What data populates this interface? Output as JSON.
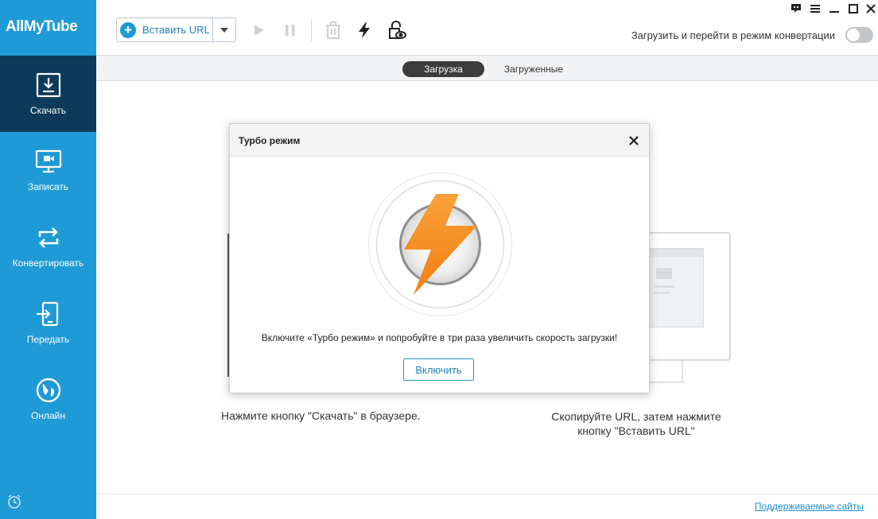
{
  "app": {
    "logo": "AllMyTube"
  },
  "sidebar": {
    "items": [
      {
        "label": "Скачать",
        "icon": "download-icon",
        "active": true
      },
      {
        "label": "Записать",
        "icon": "record-screen-icon",
        "active": false
      },
      {
        "label": "Конвертировать",
        "icon": "convert-icon",
        "active": false
      },
      {
        "label": "Передать",
        "icon": "transfer-icon",
        "active": false
      },
      {
        "label": "Онлайн",
        "icon": "globe-icon",
        "active": false
      }
    ],
    "bottom_icon": "alarm-clock-icon"
  },
  "toolbar": {
    "paste_url_label": "Вставить URL",
    "icons": [
      "play-icon",
      "pause-icon",
      "trash-icon",
      "turbo-lightning-icon",
      "lock-eye-icon"
    ],
    "convert_toggle_label": "Загрузить и перейти в режим конвертации",
    "convert_toggle_on": false
  },
  "window_controls": [
    "feedback-icon",
    "menu-icon",
    "minimize-icon",
    "maximize-icon",
    "close-icon"
  ],
  "tabs": [
    {
      "label": "Загрузка",
      "active": true
    },
    {
      "label": "Загруженные",
      "active": false
    }
  ],
  "main": {
    "hint_left": "Нажмите кнопку \"Скачать\" в браузере.",
    "hint_right": "Скопируйте URL, затем нажмите кнопку \"Вставить URL\"",
    "footer_link": "Поддерживаемые сайты"
  },
  "dialog": {
    "title": "Турбо режим",
    "message": "Включите «Турбо режим» и попробуйте в три раза увеличить скорость загрузки!",
    "enable_label": "Включить"
  },
  "colors": {
    "sidebar": "#1e9ad6",
    "sidebar_active": "#0e3a5a",
    "accent": "#1e9ad6",
    "turbo_orange": "#f7931e"
  }
}
